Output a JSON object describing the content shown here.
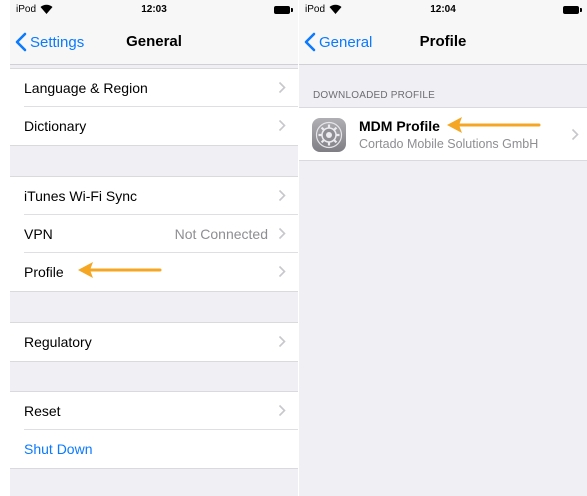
{
  "left_screen": {
    "status": {
      "carrier": "iPod",
      "time": "12:03"
    },
    "nav": {
      "back_label": "Settings",
      "title": "General"
    },
    "groups": [
      {
        "rows": [
          {
            "label": "Language & Region"
          },
          {
            "label": "Dictionary"
          }
        ]
      },
      {
        "rows": [
          {
            "label": "iTunes Wi-Fi Sync"
          },
          {
            "label": "VPN",
            "value": "Not Connected"
          },
          {
            "label": "Profile"
          }
        ]
      },
      {
        "rows": [
          {
            "label": "Regulatory"
          }
        ]
      },
      {
        "rows": [
          {
            "label": "Reset"
          },
          {
            "label": "Shut Down"
          }
        ]
      }
    ]
  },
  "right_screen": {
    "status": {
      "carrier": "iPod",
      "time": "12:04"
    },
    "nav": {
      "back_label": "General",
      "title": "Profile"
    },
    "section_header": "DOWNLOADED PROFILE",
    "profile": {
      "name": "MDM Profile",
      "organization": "Cortado Mobile Solutions GmbH",
      "icon": "settings-gear-icon"
    }
  },
  "colors": {
    "ios_blue": "#0a7aff",
    "annotation_arrow": "#f5a623",
    "background": "#efeff4",
    "secondary_text": "#8e8e93"
  }
}
